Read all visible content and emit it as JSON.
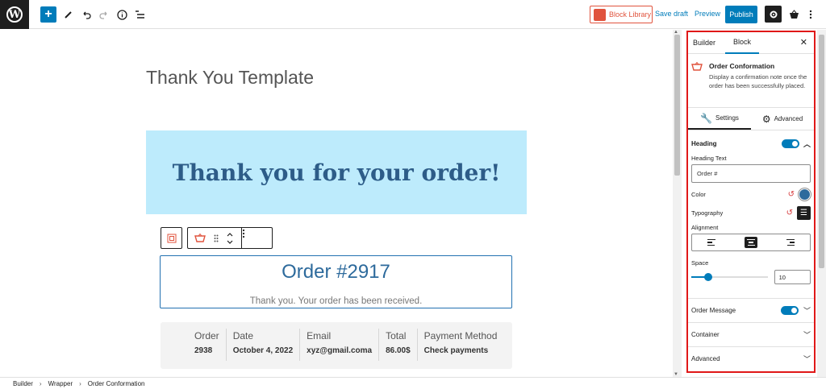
{
  "topbar": {
    "wp_logo": "W",
    "add_icon": "+",
    "block_library_label": "Block Library",
    "save_draft_label": "Save draft",
    "preview_label": "Preview",
    "publish_label": "Publish",
    "icons": [
      "add-icon",
      "edit-icon",
      "undo-icon",
      "redo-icon",
      "info-icon",
      "list-view-icon",
      "settings-icon",
      "cart-icon",
      "more-icon"
    ]
  },
  "canvas": {
    "template_title": "Thank You Template",
    "hero_text": "Thank you for your order!",
    "order_heading": "Order #2917",
    "order_message": "Thank you. Your order has been received.",
    "order_table": {
      "columns": [
        {
          "header": "Order",
          "value": "2938"
        },
        {
          "header": "Date",
          "value": "October 4, 2022"
        },
        {
          "header": "Email",
          "value": "xyz@gmail.coma"
        },
        {
          "header": "Total",
          "value": "86.00$"
        },
        {
          "header": "Payment Method",
          "value": "Check payments"
        }
      ]
    }
  },
  "sidebar": {
    "tabs": [
      "Builder",
      "Block"
    ],
    "active_tab": "Block",
    "block_title": "Order Conformation",
    "block_description": "Display a confirmation note once the order has been successfully placed.",
    "subtabs": [
      "Settings",
      "Advanced"
    ],
    "heading_section": "Heading",
    "heading_text_label": "Heading Text",
    "heading_text_value": "Order #",
    "color_label": "Color",
    "color_value": "#2d6a9c",
    "typography_label": "Typography",
    "alignment_label": "Alignment",
    "alignment_selected": "center",
    "space_label": "Space",
    "space_value": "10",
    "space_fraction": 0.22,
    "panels": [
      "Order Message",
      "Container",
      "Advanced"
    ],
    "accent_color": "#007cba",
    "highlight_border": "#e01818"
  },
  "footer": {
    "breadcrumb": [
      "Builder",
      "Wrapper",
      "Order Conformation"
    ]
  }
}
